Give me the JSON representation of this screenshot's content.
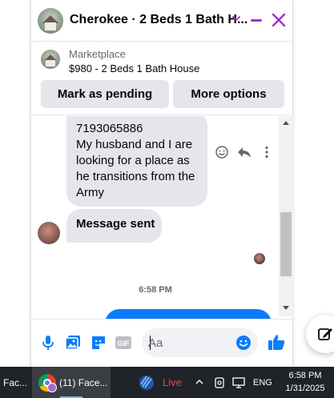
{
  "header": {
    "title": "Cherokee · 2 Beds 1 Bath H...",
    "accent": "#a030d0"
  },
  "listing": {
    "source": "Marketplace",
    "price_title": "$980 - 2 Beds 1 Bath House",
    "mark_pending_label": "Mark as pending",
    "more_options_label": "More options"
  },
  "messages": {
    "bubble1_lines": [
      "7193065886",
      "My husband and I are",
      "looking for a place as",
      "he transitions from the",
      "Army"
    ],
    "bubble2": "Message sent",
    "timestamp": "6:58 PM",
    "bubble_color": "#e4e6eb",
    "outgoing_color": "#0a7cff"
  },
  "composer": {
    "placeholder": "Aa",
    "icons": [
      "microphone-icon",
      "gallery-icon",
      "sticker-icon",
      "gif-icon",
      "emoji-icon",
      "thumbs-up-icon"
    ],
    "accent": "#0a7cff"
  },
  "taskbar": {
    "item1": "Fac...",
    "item2": "(11) Face...",
    "live": "Live",
    "lang": "ENG",
    "time": "6:58 PM",
    "date": "1/31/2025"
  }
}
